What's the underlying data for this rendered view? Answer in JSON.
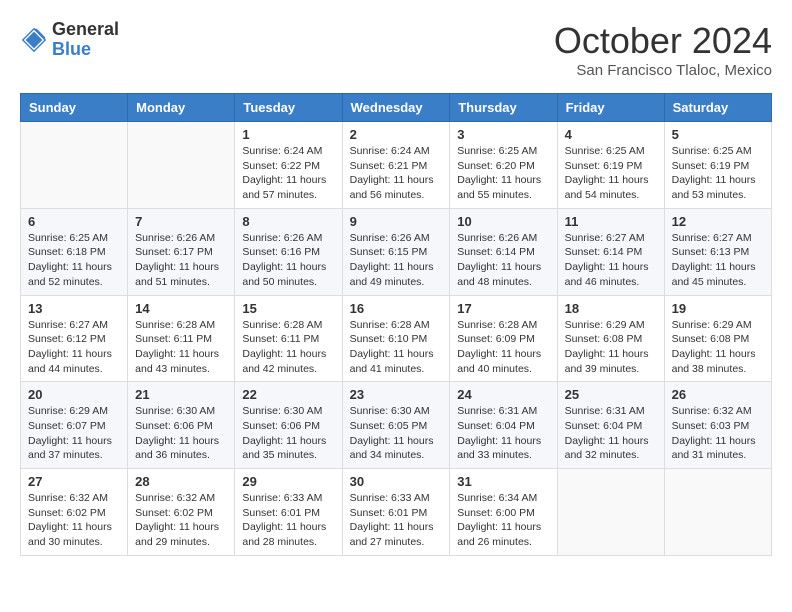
{
  "header": {
    "logo_general": "General",
    "logo_blue": "Blue",
    "month_title": "October 2024",
    "subtitle": "San Francisco Tlaloc, Mexico"
  },
  "weekdays": [
    "Sunday",
    "Monday",
    "Tuesday",
    "Wednesday",
    "Thursday",
    "Friday",
    "Saturday"
  ],
  "weeks": [
    [
      {
        "day": "",
        "info": ""
      },
      {
        "day": "",
        "info": ""
      },
      {
        "day": "1",
        "info": "Sunrise: 6:24 AM\nSunset: 6:22 PM\nDaylight: 11 hours and 57 minutes."
      },
      {
        "day": "2",
        "info": "Sunrise: 6:24 AM\nSunset: 6:21 PM\nDaylight: 11 hours and 56 minutes."
      },
      {
        "day": "3",
        "info": "Sunrise: 6:25 AM\nSunset: 6:20 PM\nDaylight: 11 hours and 55 minutes."
      },
      {
        "day": "4",
        "info": "Sunrise: 6:25 AM\nSunset: 6:19 PM\nDaylight: 11 hours and 54 minutes."
      },
      {
        "day": "5",
        "info": "Sunrise: 6:25 AM\nSunset: 6:19 PM\nDaylight: 11 hours and 53 minutes."
      }
    ],
    [
      {
        "day": "6",
        "info": "Sunrise: 6:25 AM\nSunset: 6:18 PM\nDaylight: 11 hours and 52 minutes."
      },
      {
        "day": "7",
        "info": "Sunrise: 6:26 AM\nSunset: 6:17 PM\nDaylight: 11 hours and 51 minutes."
      },
      {
        "day": "8",
        "info": "Sunrise: 6:26 AM\nSunset: 6:16 PM\nDaylight: 11 hours and 50 minutes."
      },
      {
        "day": "9",
        "info": "Sunrise: 6:26 AM\nSunset: 6:15 PM\nDaylight: 11 hours and 49 minutes."
      },
      {
        "day": "10",
        "info": "Sunrise: 6:26 AM\nSunset: 6:14 PM\nDaylight: 11 hours and 48 minutes."
      },
      {
        "day": "11",
        "info": "Sunrise: 6:27 AM\nSunset: 6:14 PM\nDaylight: 11 hours and 46 minutes."
      },
      {
        "day": "12",
        "info": "Sunrise: 6:27 AM\nSunset: 6:13 PM\nDaylight: 11 hours and 45 minutes."
      }
    ],
    [
      {
        "day": "13",
        "info": "Sunrise: 6:27 AM\nSunset: 6:12 PM\nDaylight: 11 hours and 44 minutes."
      },
      {
        "day": "14",
        "info": "Sunrise: 6:28 AM\nSunset: 6:11 PM\nDaylight: 11 hours and 43 minutes."
      },
      {
        "day": "15",
        "info": "Sunrise: 6:28 AM\nSunset: 6:11 PM\nDaylight: 11 hours and 42 minutes."
      },
      {
        "day": "16",
        "info": "Sunrise: 6:28 AM\nSunset: 6:10 PM\nDaylight: 11 hours and 41 minutes."
      },
      {
        "day": "17",
        "info": "Sunrise: 6:28 AM\nSunset: 6:09 PM\nDaylight: 11 hours and 40 minutes."
      },
      {
        "day": "18",
        "info": "Sunrise: 6:29 AM\nSunset: 6:08 PM\nDaylight: 11 hours and 39 minutes."
      },
      {
        "day": "19",
        "info": "Sunrise: 6:29 AM\nSunset: 6:08 PM\nDaylight: 11 hours and 38 minutes."
      }
    ],
    [
      {
        "day": "20",
        "info": "Sunrise: 6:29 AM\nSunset: 6:07 PM\nDaylight: 11 hours and 37 minutes."
      },
      {
        "day": "21",
        "info": "Sunrise: 6:30 AM\nSunset: 6:06 PM\nDaylight: 11 hours and 36 minutes."
      },
      {
        "day": "22",
        "info": "Sunrise: 6:30 AM\nSunset: 6:06 PM\nDaylight: 11 hours and 35 minutes."
      },
      {
        "day": "23",
        "info": "Sunrise: 6:30 AM\nSunset: 6:05 PM\nDaylight: 11 hours and 34 minutes."
      },
      {
        "day": "24",
        "info": "Sunrise: 6:31 AM\nSunset: 6:04 PM\nDaylight: 11 hours and 33 minutes."
      },
      {
        "day": "25",
        "info": "Sunrise: 6:31 AM\nSunset: 6:04 PM\nDaylight: 11 hours and 32 minutes."
      },
      {
        "day": "26",
        "info": "Sunrise: 6:32 AM\nSunset: 6:03 PM\nDaylight: 11 hours and 31 minutes."
      }
    ],
    [
      {
        "day": "27",
        "info": "Sunrise: 6:32 AM\nSunset: 6:02 PM\nDaylight: 11 hours and 30 minutes."
      },
      {
        "day": "28",
        "info": "Sunrise: 6:32 AM\nSunset: 6:02 PM\nDaylight: 11 hours and 29 minutes."
      },
      {
        "day": "29",
        "info": "Sunrise: 6:33 AM\nSunset: 6:01 PM\nDaylight: 11 hours and 28 minutes."
      },
      {
        "day": "30",
        "info": "Sunrise: 6:33 AM\nSunset: 6:01 PM\nDaylight: 11 hours and 27 minutes."
      },
      {
        "day": "31",
        "info": "Sunrise: 6:34 AM\nSunset: 6:00 PM\nDaylight: 11 hours and 26 minutes."
      },
      {
        "day": "",
        "info": ""
      },
      {
        "day": "",
        "info": ""
      }
    ]
  ]
}
